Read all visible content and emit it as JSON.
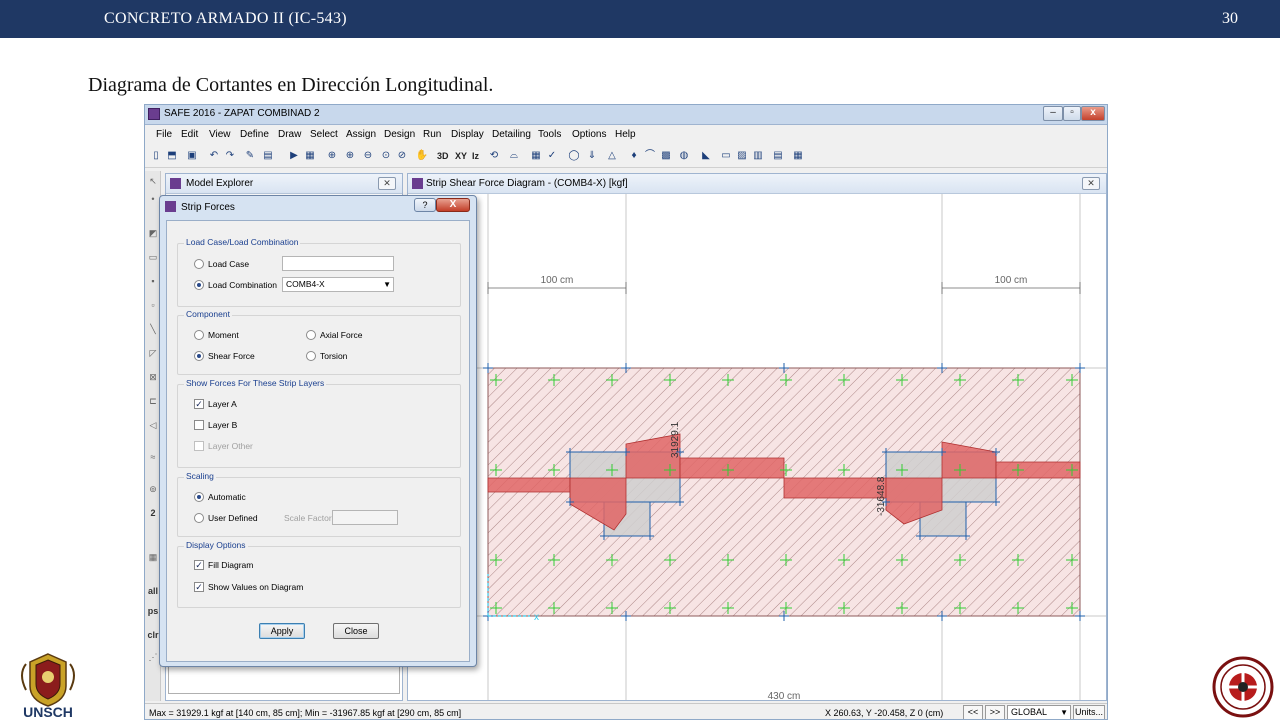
{
  "slide": {
    "course": "CONCRETO ARMADO II (IC-543)",
    "page_number": "30",
    "title": "Diagrama de Cortantes en Dirección Longitudinal.",
    "logo_left_text": "UNSCH",
    "colors": {
      "header_bg": "#1f3864",
      "diagram_fill": "#e06666",
      "grid_line": "#1f5faa",
      "mesh_plus": "#33cc33"
    }
  },
  "window": {
    "title": "SAFE 2016 - ZAPAT COMBINAD 2",
    "menu": [
      "File",
      "Edit",
      "View",
      "Define",
      "Draw",
      "Select",
      "Assign",
      "Design",
      "Run",
      "Display",
      "Detailing",
      "Tools",
      "Options",
      "Help"
    ],
    "toolbar_text_buttons": [
      "3D",
      "XY",
      "Iz"
    ]
  },
  "left_toolbar_labels": [
    "2",
    "all",
    "ps",
    "clr"
  ],
  "model_explorer": {
    "title": "Model Explorer"
  },
  "diagram_panel": {
    "title": "Strip Shear Force Diagram  - (COMB4-X)  [kgf]",
    "dim_left": "100 cm",
    "dim_right": "100 cm",
    "dim_bottom": "430 cm",
    "value_left": "31929.1",
    "value_right": "-31648.8"
  },
  "dialog": {
    "title": "Strip Forces",
    "help_label": "?",
    "close_label": "X",
    "load_group": {
      "label": "Load Case/Load Combination",
      "load_case_label": "Load Case",
      "load_case_selected": false,
      "load_combination_label": "Load Combination",
      "load_combination_selected": true,
      "combination_value": "COMB4-X"
    },
    "component_group": {
      "label": "Component",
      "options": [
        {
          "label": "Moment",
          "selected": false
        },
        {
          "label": "Axial Force",
          "selected": false
        },
        {
          "label": "Shear Force",
          "selected": true
        },
        {
          "label": "Torsion",
          "selected": false
        }
      ]
    },
    "layers_group": {
      "label": "Show Forces For These Strip Layers",
      "layer_a": {
        "label": "Layer A",
        "checked": true,
        "enabled": true
      },
      "layer_b": {
        "label": "Layer B",
        "checked": false,
        "enabled": true
      },
      "layer_other": {
        "label": "Layer Other",
        "checked": false,
        "enabled": false
      }
    },
    "scaling_group": {
      "label": "Scaling",
      "automatic_label": "Automatic",
      "automatic_selected": true,
      "user_defined_label": "User Defined",
      "scale_factor_label": "Scale Factor",
      "scale_factor_value": ""
    },
    "display_group": {
      "label": "Display Options",
      "fill_diagram": {
        "label": "Fill Diagram",
        "checked": true
      },
      "show_values": {
        "label": "Show Values on Diagram",
        "checked": true
      }
    },
    "apply_label": "Apply",
    "close_button_label": "Close"
  },
  "status_bar": {
    "minmax": "Max = 31929.1 kgf at [140 cm, 85 cm];  Min = -31967.85 kgf at [290 cm, 85 cm]",
    "coords": "X 260.63,  Y -20.458,  Z 0  (cm)",
    "prev_label": "<<",
    "next_label": ">>",
    "coord_system": "GLOBAL",
    "units_label": "Units..."
  }
}
